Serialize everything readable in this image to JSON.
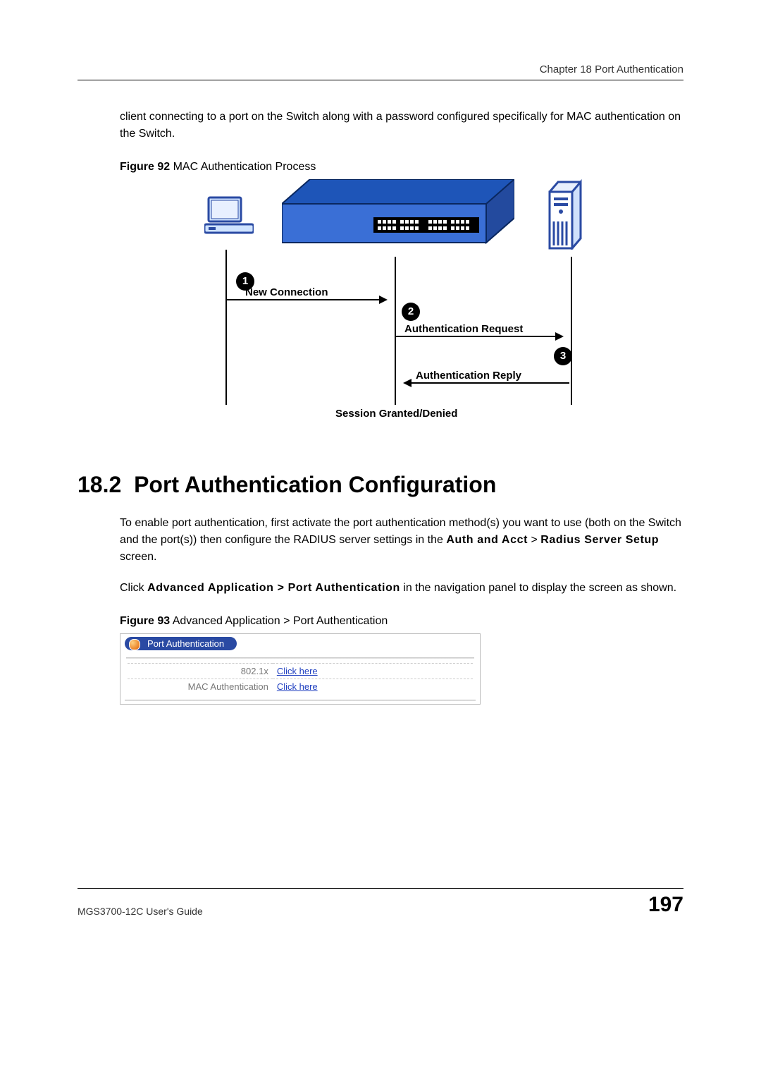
{
  "header": {
    "chapter_label": "Chapter 18 Port Authentication"
  },
  "intro_paragraph": "client connecting to a port on the Switch along with a password configured specifically for MAC authentication on the Switch.",
  "figure92": {
    "caption_bold": "Figure 92",
    "caption_rest": "   MAC Authentication Process",
    "step1_num": "1",
    "step1_label": "New Connection",
    "step2_num": "2",
    "step2_label": "Authentication Request",
    "step3_num": "3",
    "step3_label": "Authentication Reply",
    "result_label": "Session Granted/Denied"
  },
  "section": {
    "number": "18.2",
    "title": "Port Authentication Configuration",
    "para1_a": "To enable port authentication, first activate the port authentication method(s) you want to use (both on the Switch and the port(s)) then configure the RADIUS server settings in the ",
    "para1_path1": "Auth and Acct",
    "para1_b": " > ",
    "para1_path2": "Radius Server Setup",
    "para1_c": " screen.",
    "para2_a": "Click ",
    "para2_path": "Advanced Application > Port Authentication",
    "para2_b": " in the navigation panel to display the screen as shown."
  },
  "figure93": {
    "caption_bold": "Figure 93",
    "caption_rest": "   Advanced Application > Port Authentication",
    "panel_title": "Port Authentication",
    "rows": [
      {
        "label": "802.1x",
        "link": "Click here"
      },
      {
        "label": "MAC Authentication",
        "link": "Click here"
      }
    ]
  },
  "footer": {
    "guide": "MGS3700-12C User's Guide",
    "page": "197"
  }
}
